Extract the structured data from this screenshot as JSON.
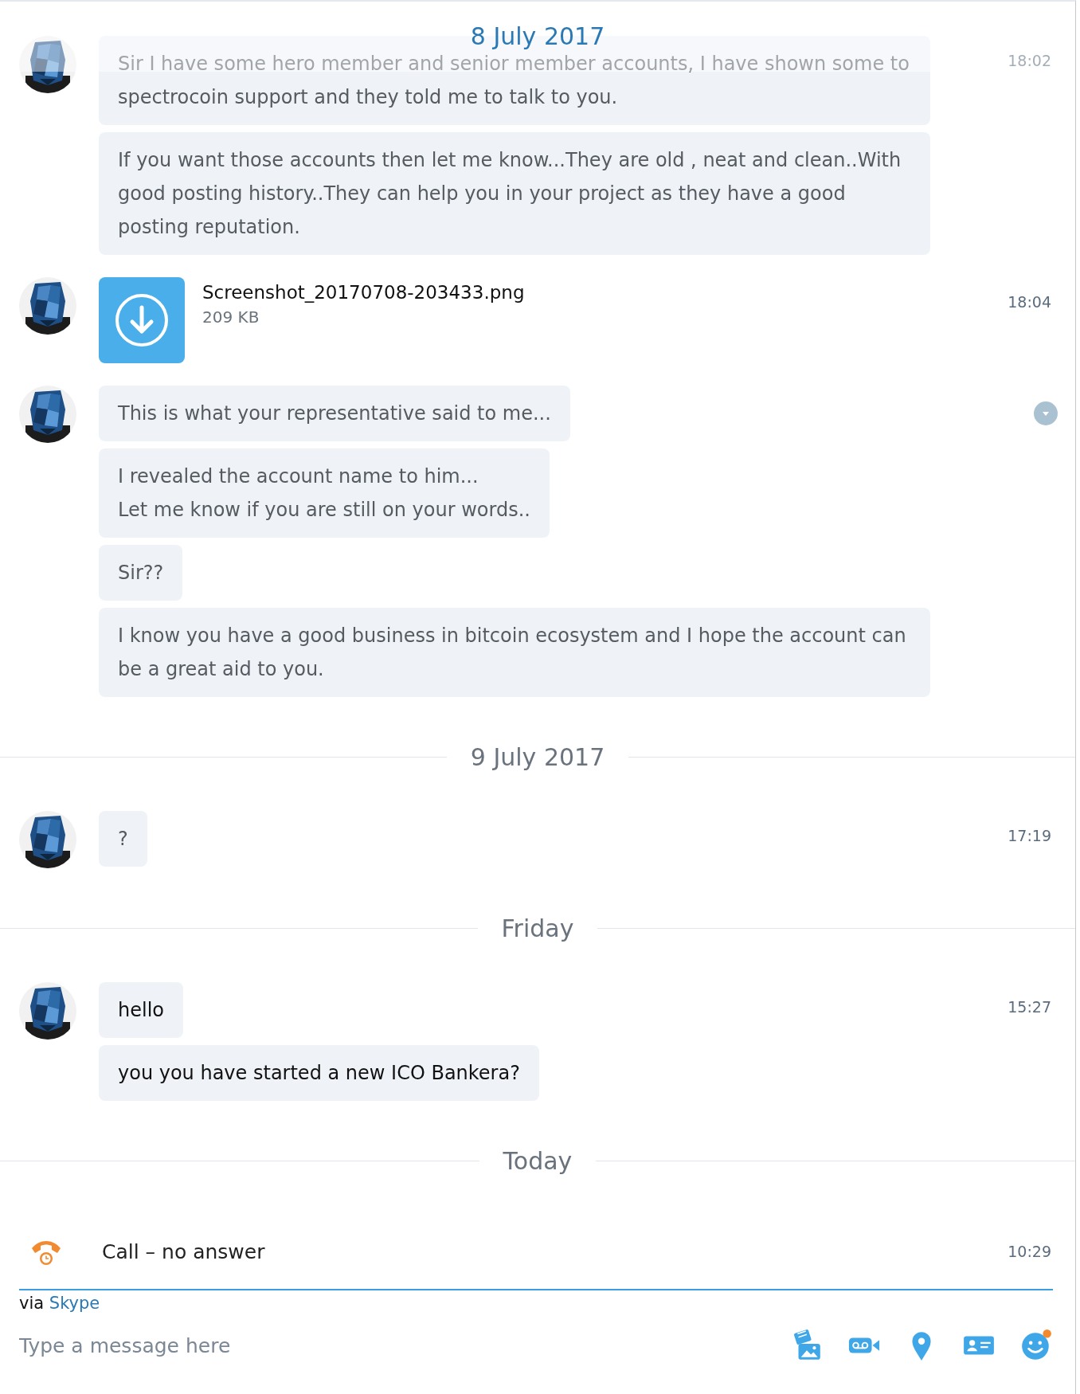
{
  "sticky_date": "8 July 2017",
  "entries": [
    {
      "kind": "messages",
      "time": "18:02",
      "unread": false,
      "menu_shown": false,
      "messages": [
        "Sir I have some hero member and senior member accounts, I have shown some to spectrocoin support and they told me to talk to you.",
        "If you want those accounts then let me know...They are old , neat and clean..With good posting history..They can help you in your project as they have a good posting reputation."
      ]
    },
    {
      "kind": "file",
      "time": "18:04",
      "name": "Screenshot_20170708-203433.png",
      "size": "209 KB"
    },
    {
      "kind": "messages",
      "unread": false,
      "menu_shown": true,
      "messages": [
        "This is what your representative said to me...",
        "I revealed the account name to him...\nLet me know if you are still on your words..",
        "Sir??",
        "I know you have a good business in bitcoin ecosystem and I hope the account can be a great aid to you."
      ]
    },
    {
      "kind": "day",
      "label": "9 July 2017"
    },
    {
      "kind": "messages",
      "time": "17:19",
      "unread": false,
      "menu_shown": false,
      "messages": [
        "?"
      ]
    },
    {
      "kind": "day",
      "label": "Friday"
    },
    {
      "kind": "messages",
      "time": "15:27",
      "unread": true,
      "menu_shown": false,
      "messages": [
        "hello",
        "you you have started a new ICO Bankera?"
      ]
    },
    {
      "kind": "day",
      "label": "Today"
    },
    {
      "kind": "call",
      "label": "Call – no answer",
      "time": "10:29"
    }
  ],
  "composer": {
    "via": "via",
    "service": "Skype",
    "placeholder": "Type a message here"
  }
}
